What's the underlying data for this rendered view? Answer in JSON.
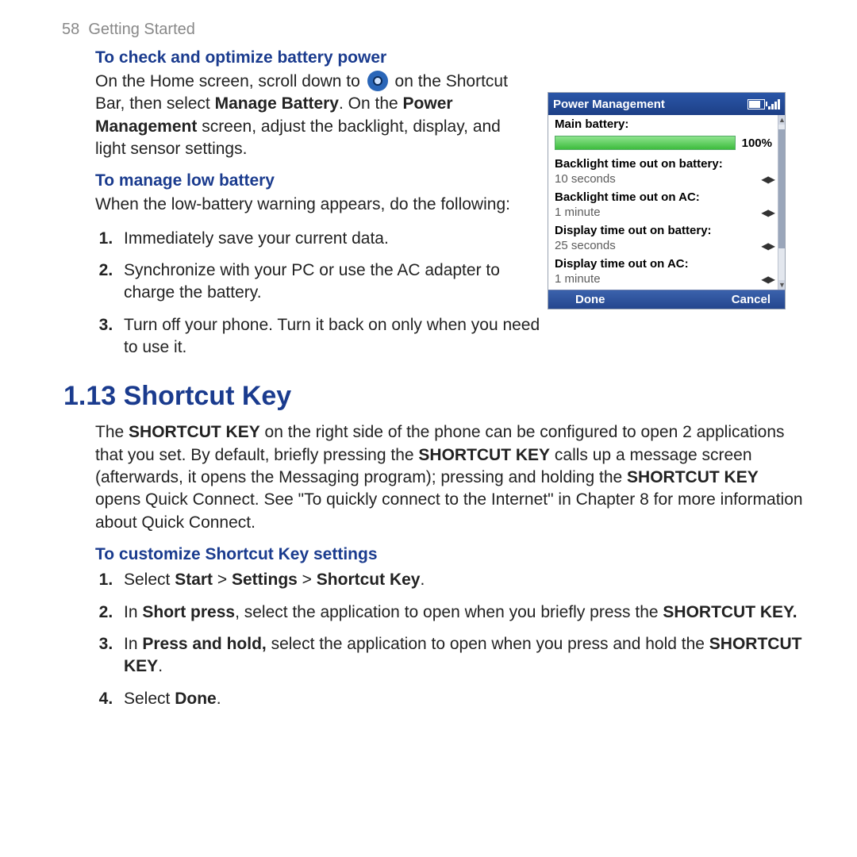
{
  "page_number": "58",
  "chapter": "Getting Started",
  "section1": {
    "sub1": "To check and optimize battery power",
    "p1_a": "On the Home screen, scroll down to",
    "p1_b": "on the Shortcut Bar, then select ",
    "p1_b_bold": "Manage Battery",
    "p1_c": ". On the ",
    "p1_c_bold": "Power Management",
    "p1_d": " screen, adjust the backlight, display, and light sensor settings.",
    "sub2": "To manage low battery",
    "p2": "When the low-battery warning appears, do the following:",
    "steps": [
      "Immediately save your current data.",
      "Synchronize with your PC or use the AC adapter to charge the battery.",
      "Turn off your phone. Turn it back on only when you need to use it."
    ]
  },
  "section2": {
    "title": "1.13  Shortcut Key",
    "p_a": "The ",
    "p_b1": "SHORTCUT KEY",
    "p_c": " on the right side of the phone can be configured to open 2 applications that you set. By default, briefly pressing the ",
    "p_b2": "SHORTCUT KEY",
    "p_d": " calls up a message screen (afterwards, it opens the Messaging program); pressing and holding the ",
    "p_b3": "SHORTCUT KEY",
    "p_e": " opens Quick Connect. See \"To quickly connect to the Internet\" in Chapter 8 for more information about Quick Connect.",
    "sub": "To customize Shortcut Key settings",
    "steps": {
      "s1_a": "Select ",
      "s1_b": "Start",
      "s1_c": " > ",
      "s1_d": "Settings",
      "s1_e": " > ",
      "s1_f": "Shortcut Key",
      "s1_g": ".",
      "s2_a": "In ",
      "s2_b": "Short press",
      "s2_c": ", select the application to open when you briefly press the ",
      "s2_d": "SHORTCUT KEY.",
      "s3_a": "In ",
      "s3_b": "Press and hold,",
      "s3_c": " select the application to open when you press and hold the ",
      "s3_d": "SHORTCUT KEY",
      "s3_e": ".",
      "s4_a": "Select ",
      "s4_b": "Done",
      "s4_c": "."
    }
  },
  "phone": {
    "title": "Power Management",
    "rows": {
      "main_battery": "Main battery:",
      "pct": "100%",
      "bl_batt_label": "Backlight time out on battery:",
      "bl_batt_value": "10 seconds",
      "bl_ac_label": "Backlight time out on AC:",
      "bl_ac_value": "1 minute",
      "disp_batt_label": "Display time out on battery:",
      "disp_batt_value": "25 seconds",
      "disp_ac_label": "Display time out on AC:",
      "disp_ac_value": "1 minute"
    },
    "softkeys": {
      "left": "Done",
      "right": "Cancel"
    },
    "progress_pct": 100
  }
}
